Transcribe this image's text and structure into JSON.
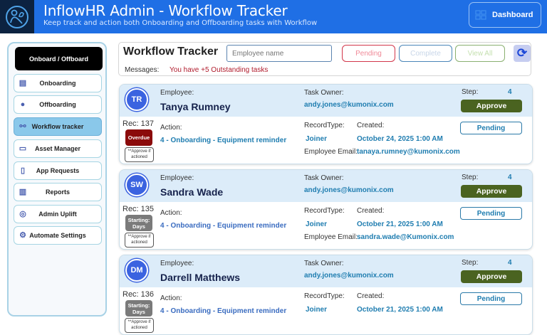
{
  "header": {
    "title": "InflowHR Admin - Workflow Tracker",
    "subtitle": "Keep track and action both Onboarding and Offboarding tasks with Workflow",
    "dashboard_label": "Dashboard"
  },
  "sidebar": {
    "heading": "Onboard / Offboard",
    "items": [
      {
        "label": "Onboarding",
        "icon": "clipboard-icon"
      },
      {
        "label": "Offboarding",
        "icon": "user-remove-icon"
      },
      {
        "label": "Workflow tracker",
        "icon": "workflow-icon",
        "active": true
      },
      {
        "label": "Asset Manager",
        "icon": "devices-icon"
      },
      {
        "label": "App Requests",
        "icon": "app-icon"
      },
      {
        "label": "Reports",
        "icon": "report-icon"
      },
      {
        "label": "Admin Uplift",
        "icon": "admin-icon"
      },
      {
        "label": "Automate Settings",
        "icon": "gear-icon"
      }
    ]
  },
  "toolbar": {
    "title": "Workflow Tracker",
    "search_placeholder": "Employee name",
    "pending": "Pending",
    "complete": "Complete",
    "view_all": "View All",
    "messages_label": "Messages:",
    "message": "You have +5 Outstanding tasks"
  },
  "labels": {
    "employee": "Employee:",
    "task_owner": "Task Owner:",
    "step": "Step:",
    "action": "Action:",
    "record_type": "RecordType:",
    "created": "Created:",
    "employee_email": "Employee Email:",
    "approve": "Approve",
    "pending": "Pending",
    "note": "**Approve if actioned"
  },
  "records": [
    {
      "initials": "TR",
      "name": "Tanya Rumney",
      "owner": "andy.jones@kumonix.com",
      "step": "4",
      "rec": "Rec: 137",
      "badge": "Overdue",
      "badge_color": "#8b0a0a",
      "action": "4 - Onboarding - Equipment reminder",
      "record_type": "Joiner",
      "created": "October 24, 2025 1:00 AM",
      "email": "tanaya.rumney@kumonix.com"
    },
    {
      "initials": "SW",
      "name": "Sandra Wade",
      "owner": "andy.jones@kumonix.com",
      "step": "4",
      "rec": "Rec: 135",
      "badge": "Starting: Days",
      "badge_color": "#7a7a7a",
      "action": "4 - Onboarding - Equipment reminder",
      "record_type": "Joiner",
      "created": "October 21, 2025 1:00 AM",
      "email": "sandra.wade@Kumonix.com"
    },
    {
      "initials": "DM",
      "name": "Darrell Matthews",
      "owner": "andy.jones@kumonix.com",
      "step": "4",
      "rec": "Rec: 136",
      "badge": "Starting: Days",
      "badge_color": "#7a7a7a",
      "action": "4 - Onboarding - Equipment reminder",
      "record_type": "Joiner",
      "created": "October 21, 2025 1:00 AM",
      "email": ""
    }
  ]
}
